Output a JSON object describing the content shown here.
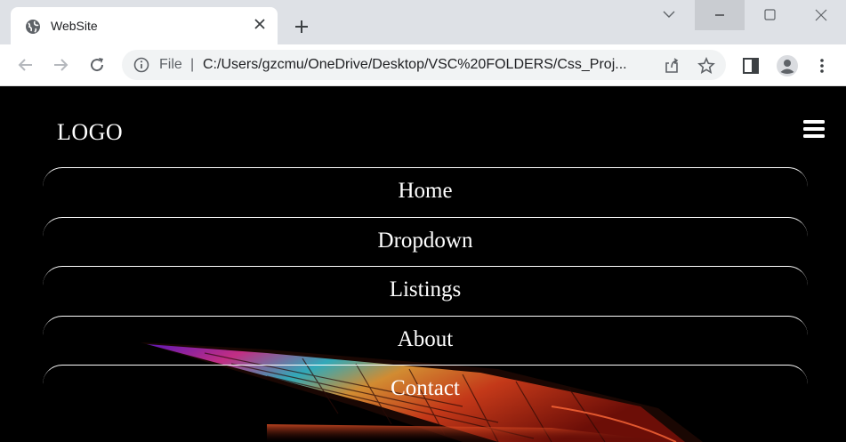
{
  "browser": {
    "tab": {
      "title": "WebSite",
      "favicon": "globe-icon"
    },
    "window_controls": [
      "chevron-down-icon",
      "minimize-icon",
      "maximize-icon",
      "close-icon"
    ],
    "address_bar": {
      "scheme_label": "File",
      "separator": "|",
      "url": "C:/Users/gzcmu/OneDrive/Desktop/VSC%20FOLDERS/Css_Proj..."
    },
    "toolbar_icons": [
      "back-icon",
      "forward-icon",
      "reload-icon",
      "info-icon",
      "share-icon",
      "star-icon",
      "side-panel-icon",
      "profile-icon",
      "kebab-menu-icon"
    ]
  },
  "page": {
    "logo": "LOGO",
    "menu_icon": "hamburger-icon",
    "nav": [
      {
        "label": "Home"
      },
      {
        "label": "Dropdown"
      },
      {
        "label": "Listings"
      },
      {
        "label": "About"
      },
      {
        "label": "Contact"
      }
    ],
    "colors": {
      "background": "#000000",
      "text": "#ffffff",
      "chrome": "#dee1e6"
    }
  }
}
